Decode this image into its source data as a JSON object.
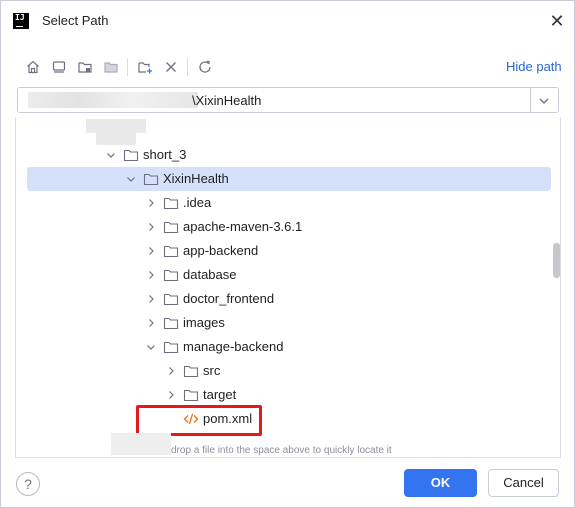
{
  "window": {
    "title": "Select Path",
    "app_logo": "IJ"
  },
  "toolbar": {
    "icons": [
      "home-icon",
      "desktop-icon",
      "project-folder-icon",
      "module-folder-icon",
      "new-folder-icon",
      "delete-icon",
      "refresh-icon"
    ],
    "hide_path_label": "Hide path"
  },
  "path_field": {
    "value": "\\XixinHealth"
  },
  "tree": {
    "items": [
      {
        "label": "short_3",
        "expanded": true,
        "type": "folder"
      },
      {
        "label": "XixinHealth",
        "expanded": true,
        "type": "folder",
        "selected": true
      },
      {
        "label": ".idea",
        "expanded": false,
        "type": "folder"
      },
      {
        "label": "apache-maven-3.6.1",
        "expanded": false,
        "type": "folder"
      },
      {
        "label": "app-backend",
        "expanded": false,
        "type": "folder"
      },
      {
        "label": "database",
        "expanded": false,
        "type": "folder"
      },
      {
        "label": "doctor_frontend",
        "expanded": false,
        "type": "folder"
      },
      {
        "label": "images",
        "expanded": false,
        "type": "folder"
      },
      {
        "label": "manage-backend",
        "expanded": true,
        "type": "folder"
      },
      {
        "label": "src",
        "expanded": false,
        "type": "folder"
      },
      {
        "label": "target",
        "expanded": false,
        "type": "folder"
      },
      {
        "label": "pom.xml",
        "type": "xml-file",
        "highlighted": true
      }
    ],
    "hint": "drop a file into the space above to quickly locate it"
  },
  "footer": {
    "help": "?",
    "ok_label": "OK",
    "cancel_label": "Cancel"
  },
  "colors": {
    "accent": "#3574f0",
    "link": "#2866d5",
    "selection": "#d5e1fb",
    "highlight_box": "#e3191c",
    "xml_icon": "#e66d17"
  }
}
